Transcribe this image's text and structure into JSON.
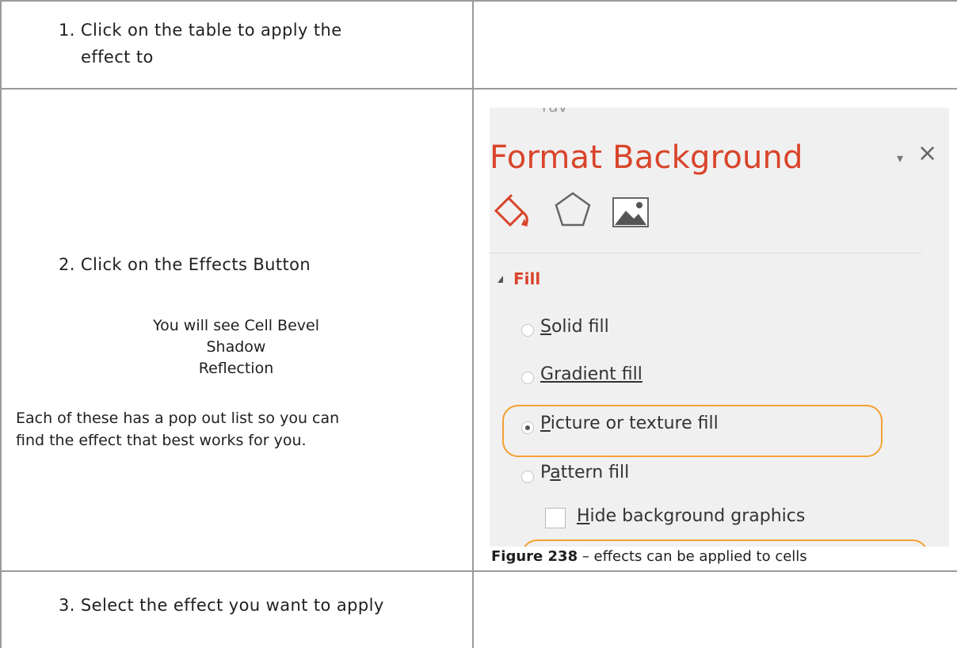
{
  "steps": {
    "step1_line1": "1. Click on the table to apply the",
    "step1_line2": "effect to",
    "step2": "2. Click on the Effects Button",
    "you_will_see": "You will see Cell Bevel",
    "shadow": "Shadow",
    "reflection": "Reflection",
    "para_line1": "Each of these has a pop out list so you can",
    "para_line2": "find the effect that best works for you.",
    "step3": "3. Select the effect you want to apply"
  },
  "panel": {
    "cut_text": "rav",
    "title": "Format Background",
    "pin_glyph": "▾",
    "close_glyph": "×",
    "fill_header": "Fill",
    "opt_solid_pre": "",
    "opt_solid_u": "S",
    "opt_solid_post": "olid fill",
    "opt_gradient_u": "G",
    "opt_gradient_post": "radient fill",
    "opt_picture_u": "P",
    "opt_picture_post": "icture or texture fill",
    "opt_pattern_pre": "P",
    "opt_pattern_u": "a",
    "opt_pattern_post": "ttern fill",
    "hide_u": "H",
    "hide_post": "ide background graphics",
    "icons": [
      "paint-bucket-icon",
      "pentagon-icon",
      "picture-icon"
    ],
    "accent": "#d9442a",
    "highlight": "#f5a032"
  },
  "caption": {
    "label": "Figure 238",
    "text": " – effects can be applied to cells"
  }
}
